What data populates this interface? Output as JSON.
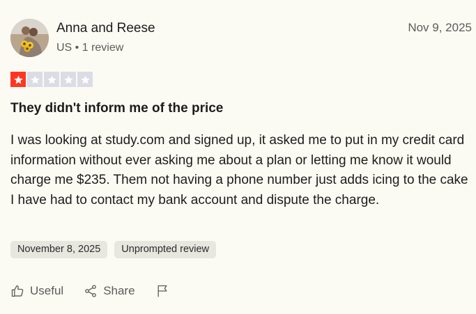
{
  "review": {
    "author_name": "Anna and Reese",
    "author_meta": "US • 1 review",
    "date": "Nov 9, 2025",
    "rating": 1,
    "rating_max": 5,
    "title": "They didn't inform me of the price",
    "body": "I was looking at study.com and signed up, it asked me to put in my credit card information without ever asking me about a plan or letting me know it would charge me $235. Them not having a phone number just adds icing to the cake I have had to contact my bank account and dispute the charge.",
    "tags": [
      "November 8, 2025",
      "Unprompted review"
    ]
  },
  "actions": {
    "useful_label": "Useful",
    "share_label": "Share"
  },
  "icons": {
    "useful": "thumbs-up-icon",
    "share": "share-icon",
    "report": "flag-icon",
    "star": "star-icon"
  },
  "colors": {
    "star_filled": "#ff3722",
    "star_empty": "#dcdce6",
    "background": "#fcfbf3"
  }
}
